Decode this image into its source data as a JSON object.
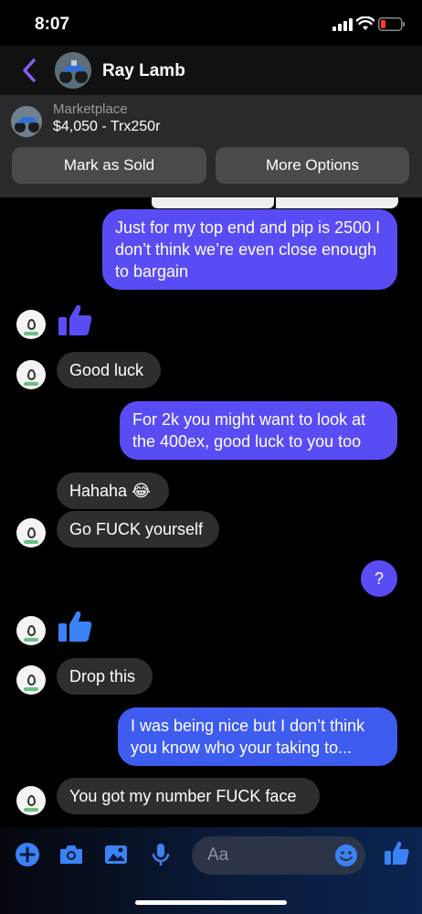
{
  "status_bar": {
    "time": "8:07"
  },
  "header": {
    "contact_name": "Ray Lamb"
  },
  "marketplace": {
    "label": "Marketplace",
    "listing": "$4,050 - Trx250r",
    "mark_sold": "Mark as Sold",
    "more_options": "More Options"
  },
  "messages": [
    {
      "from": "me",
      "text": "Just for my top end and pip is 2500 I don’t think we’re even close enough to bargain"
    },
    {
      "from": "them",
      "type": "reaction",
      "icon": "thumbs-up-icon"
    },
    {
      "from": "them",
      "text": "Good luck"
    },
    {
      "from": "me",
      "text": "For 2k you might want to look at the 400ex, good luck to you too"
    },
    {
      "from": "them",
      "text": "Hahaha 😂"
    },
    {
      "from": "them",
      "text": "Go FUCK yourself"
    },
    {
      "from": "me",
      "text": "?"
    },
    {
      "from": "them",
      "type": "reaction",
      "icon": "thumbs-up-icon"
    },
    {
      "from": "them",
      "text": "Drop this"
    },
    {
      "from": "me",
      "text": "I was being nice but I don’t think you know who your taking to..."
    },
    {
      "from": "them",
      "text": "You got my number FUCK face"
    }
  ],
  "composer": {
    "placeholder": "Aa"
  },
  "colors": {
    "outgoing": "#5a4cf5",
    "incoming": "#2e2e30",
    "accent": "#3b82f6"
  }
}
